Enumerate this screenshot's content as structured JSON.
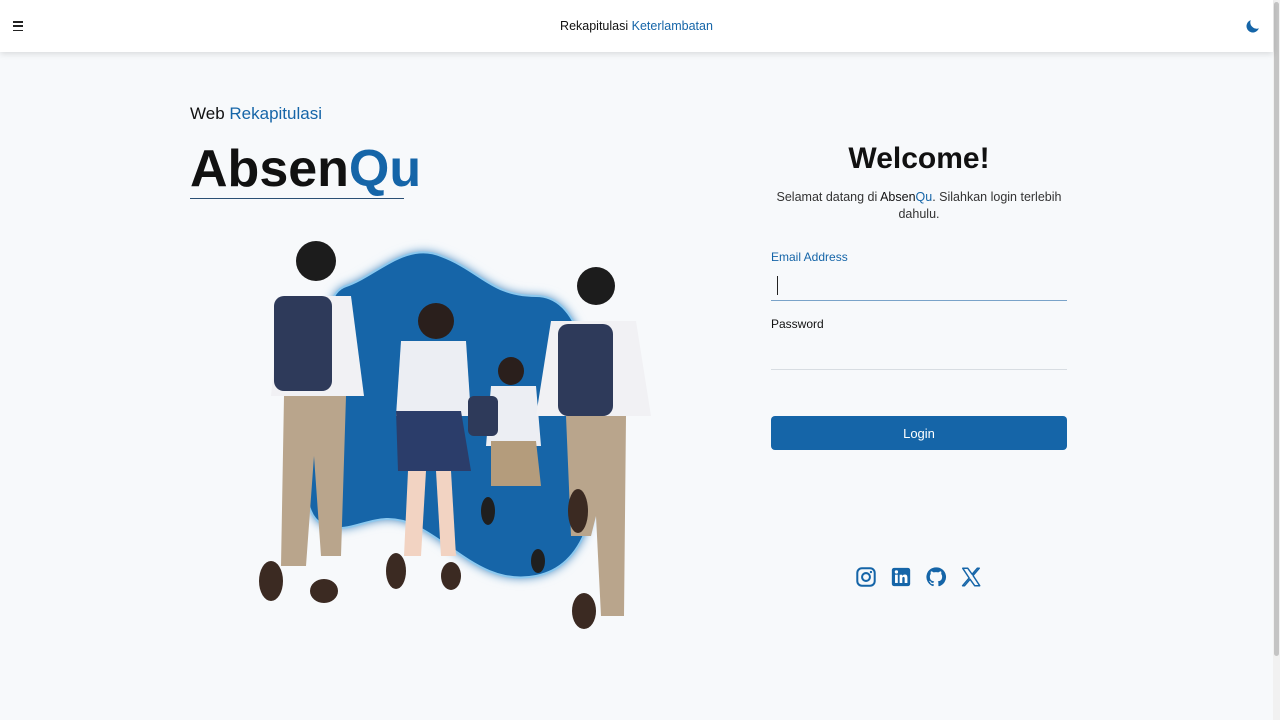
{
  "header": {
    "title_part1": "Rekapitulasi",
    "title_part2": "Keterlambatan",
    "menu_icon": "hamburger-icon",
    "theme_icon": "moon-icon"
  },
  "hero": {
    "prefix": "Web",
    "prefix_accent": "Rekapitulasi",
    "brand_part1": "Absen",
    "brand_part2": "Qu"
  },
  "login": {
    "welcome": "Welcome!",
    "subtitle_before": "Selamat datang di",
    "subtitle_brand1": "Absen",
    "subtitle_brand2": "Qu",
    "subtitle_after": ". Silahkan login terlebih dahulu.",
    "email_label": "Email Address",
    "email_value": "",
    "password_label": "Password",
    "password_value": "",
    "button_label": "Login"
  },
  "socials": [
    {
      "icon": "instagram-icon"
    },
    {
      "icon": "linkedin-icon"
    },
    {
      "icon": "github-icon"
    },
    {
      "icon": "x-icon"
    }
  ],
  "colors": {
    "accent": "#1565a8",
    "background": "#f7f9fb"
  }
}
